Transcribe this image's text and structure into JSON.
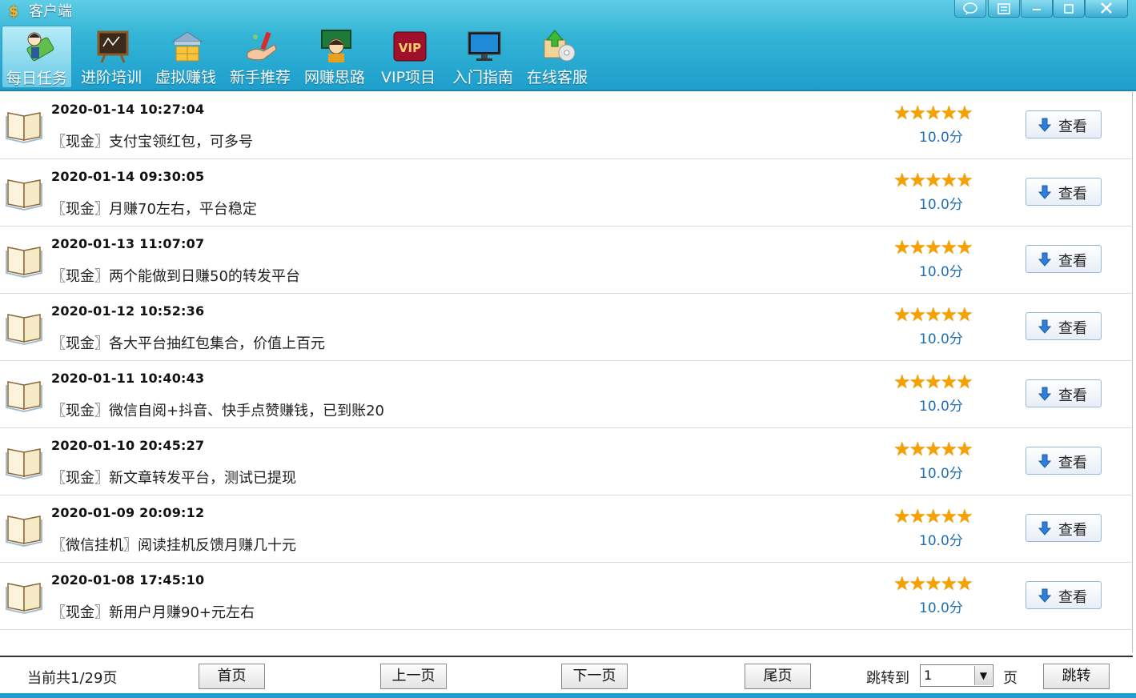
{
  "window": {
    "title": "客户端",
    "title_icon": "dollar-coin-icon",
    "controls": [
      "feedback-icon",
      "menu-icon",
      "minimize-icon",
      "maximize-icon",
      "close-icon"
    ]
  },
  "toolbar": {
    "items": [
      {
        "label": "每日任务",
        "icon": "daily-task-icon",
        "active": true
      },
      {
        "label": "进阶培训",
        "icon": "blackboard-icon",
        "active": false
      },
      {
        "label": "虚拟赚钱",
        "icon": "gold-bank-icon",
        "active": false
      },
      {
        "label": "新手推荐",
        "icon": "hand-recommend-icon",
        "active": false
      },
      {
        "label": "网赚思路",
        "icon": "thinking-person-icon",
        "active": false
      },
      {
        "label": "VIP项目",
        "icon": "vip-icon",
        "active": false
      },
      {
        "label": "入门指南",
        "icon": "monitor-icon",
        "active": false
      },
      {
        "label": "在线客服",
        "icon": "support-cd-icon",
        "active": false
      }
    ]
  },
  "list": {
    "items": [
      {
        "time": "2020-01-14 10:27:04",
        "title": "〖现金〗支付宝领红包，可多号",
        "stars": "★★★★★",
        "score": "10.0分",
        "button": "查看"
      },
      {
        "time": "2020-01-14 09:30:05",
        "title": "〖现金〗月赚70左右，平台稳定",
        "stars": "★★★★★",
        "score": "10.0分",
        "button": "查看"
      },
      {
        "time": "2020-01-13 11:07:07",
        "title": "〖现金〗两个能做到日赚50的转发平台",
        "stars": "★★★★★",
        "score": "10.0分",
        "button": "查看"
      },
      {
        "time": "2020-01-12 10:52:36",
        "title": "〖现金〗各大平台抽红包集合，价值上百元",
        "stars": "★★★★★",
        "score": "10.0分",
        "button": "查看"
      },
      {
        "time": "2020-01-11 10:40:43",
        "title": "〖现金〗微信自阅+抖音、快手点赞赚钱，已到账20",
        "stars": "★★★★★",
        "score": "10.0分",
        "button": "查看"
      },
      {
        "time": "2020-01-10 20:45:27",
        "title": "〖现金〗新文章转发平台，测试已提现",
        "stars": "★★★★★",
        "score": "10.0分",
        "button": "查看"
      },
      {
        "time": "2020-01-09 20:09:12",
        "title": "〖微信挂机〗阅读挂机反馈月赚几十元",
        "stars": "★★★★★",
        "score": "10.0分",
        "button": "查看"
      },
      {
        "time": "2020-01-08 17:45:10",
        "title": "〖现金〗新用户月赚90+元左右",
        "stars": "★★★★★",
        "score": "10.0分",
        "button": "查看"
      }
    ]
  },
  "pagination": {
    "info": "当前共1/29页",
    "first": "首页",
    "prev": "上一页",
    "next": "下一页",
    "last": "尾页",
    "jump_label": "跳转到",
    "jump_value": "1",
    "page_unit": "页",
    "jump_button": "跳转"
  }
}
